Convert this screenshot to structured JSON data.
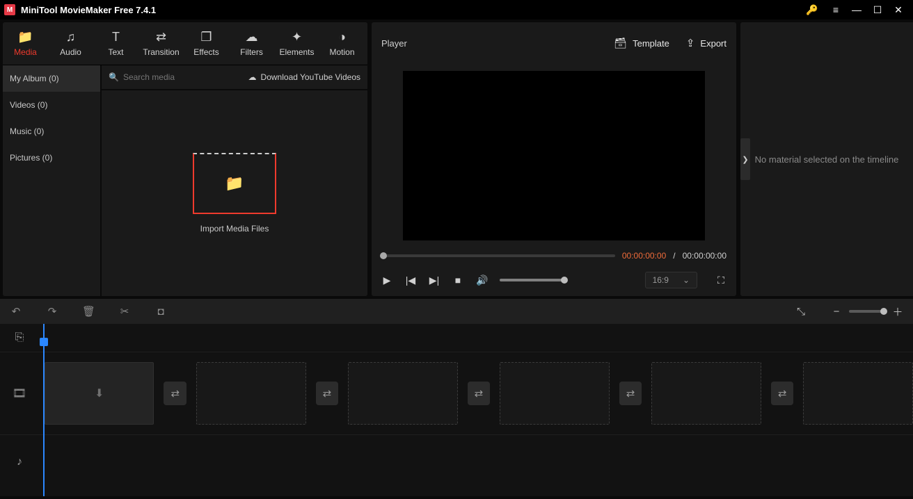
{
  "titlebar": {
    "title": "MiniTool MovieMaker Free 7.4.1"
  },
  "tool_tabs": [
    {
      "label": "Media",
      "icon": "📁",
      "active": true
    },
    {
      "label": "Audio",
      "icon": "♫",
      "active": false
    },
    {
      "label": "Text",
      "icon": "T",
      "active": false
    },
    {
      "label": "Transition",
      "icon": "⇄",
      "active": false
    },
    {
      "label": "Effects",
      "icon": "❐",
      "active": false
    },
    {
      "label": "Filters",
      "icon": "☁",
      "active": false
    },
    {
      "label": "Elements",
      "icon": "✦",
      "active": false
    },
    {
      "label": "Motion",
      "icon": "◑",
      "active": false
    }
  ],
  "categories": [
    {
      "label": "My Album (0)",
      "active": true
    },
    {
      "label": "Videos (0)",
      "active": false
    },
    {
      "label": "Music (0)",
      "active": false
    },
    {
      "label": "Pictures (0)",
      "active": false
    }
  ],
  "search": {
    "placeholder": "Search media",
    "download_label": "Download YouTube Videos"
  },
  "import": {
    "label": "Import Media Files"
  },
  "preview": {
    "title": "Player",
    "template_label": "Template",
    "export_label": "Export",
    "time_current": "00:00:00:00",
    "time_separator": "/",
    "time_duration": "00:00:00:00",
    "ratio": "16:9"
  },
  "inspector": {
    "message": "No material selected on the timeline"
  },
  "timeline_slot_count": 6
}
